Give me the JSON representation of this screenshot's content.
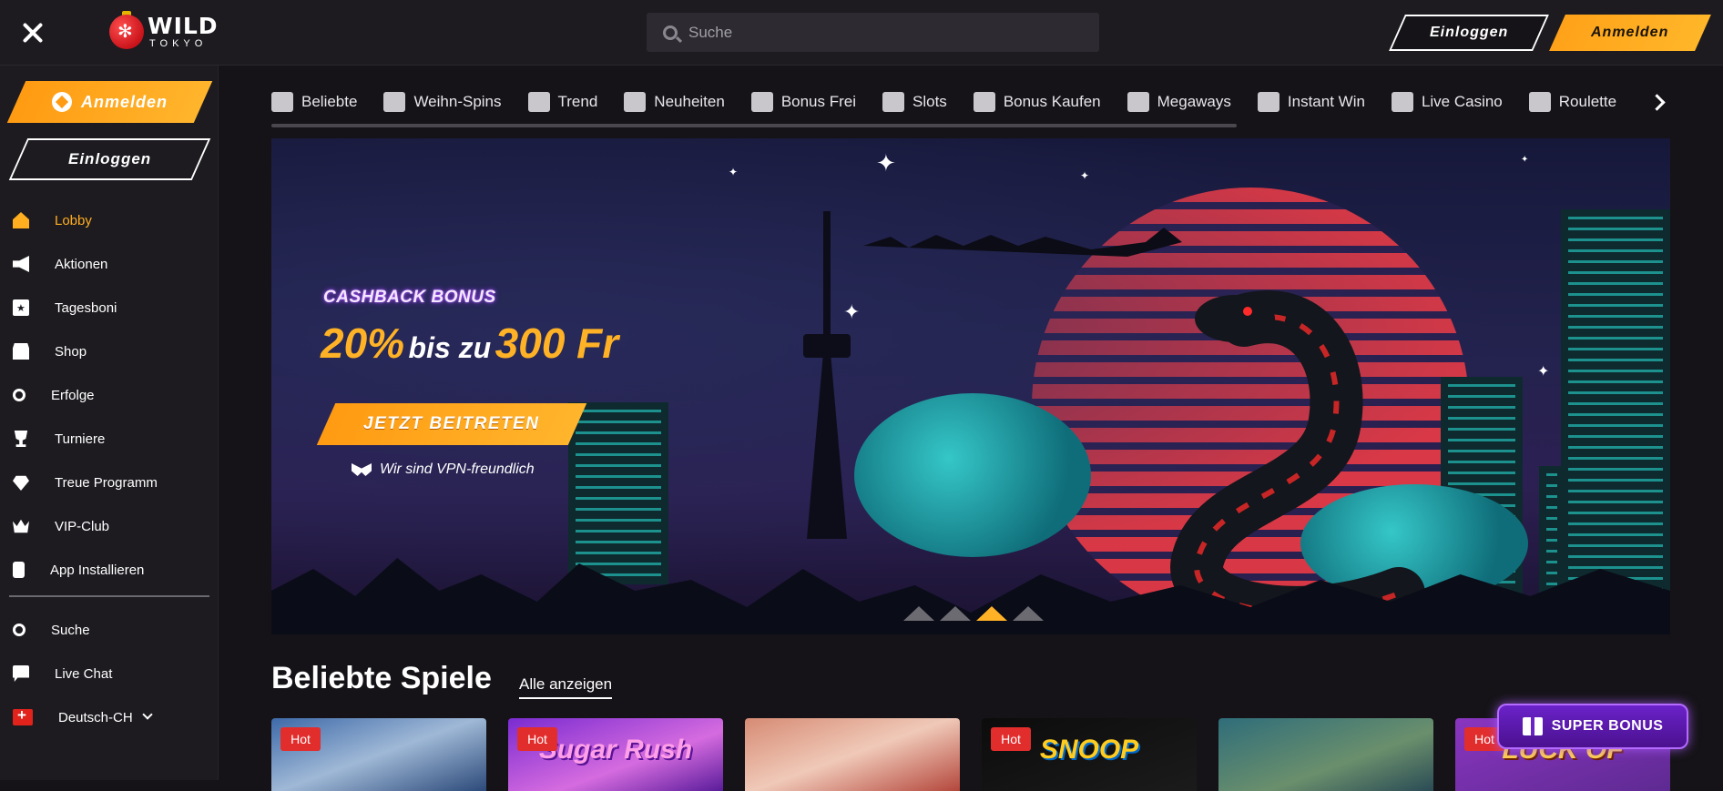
{
  "brand": {
    "name": "WILD",
    "sub": "TOKYO"
  },
  "topbar": {
    "search_placeholder": "Suche",
    "login_label": "Einloggen",
    "register_label": "Anmelden"
  },
  "sidebar": {
    "register_label": "Anmelden",
    "login_label": "Einloggen",
    "items": [
      {
        "label": "Lobby",
        "icon": "home-icon"
      },
      {
        "label": "Aktionen",
        "icon": "megaphone-icon"
      },
      {
        "label": "Tagesboni",
        "icon": "calendar-star-icon"
      },
      {
        "label": "Shop",
        "icon": "shop-icon"
      },
      {
        "label": "Erfolge",
        "icon": "award-icon"
      },
      {
        "label": "Turniere",
        "icon": "trophy-icon"
      },
      {
        "label": "Treue Programm",
        "icon": "diamond-icon"
      },
      {
        "label": "VIP-Club",
        "icon": "crown-icon"
      },
      {
        "label": "App Installieren",
        "icon": "phone-icon"
      }
    ],
    "bottom_items": [
      {
        "label": "Suche",
        "icon": "search-icon"
      },
      {
        "label": "Live Chat",
        "icon": "chat-icon"
      },
      {
        "label": "Deutsch-CH",
        "icon": "swiss-flag-icon"
      }
    ]
  },
  "categories": [
    "Beliebte",
    "Weihn-Spins",
    "Trend",
    "Neuheiten",
    "Bonus Frei",
    "Slots",
    "Bonus Kaufen",
    "Megaways",
    "Instant Win",
    "Live Casino",
    "Roulette"
  ],
  "banner": {
    "kicker": "CASHBACK BONUS",
    "percent": "20%",
    "middle": "bis zu",
    "amount": "300 Fr",
    "cta": "JETZT BEITRETEN",
    "vpn": "Wir sind VPN-freundlich"
  },
  "section": {
    "title": "Beliebte Spiele",
    "link": "Alle anzeigen",
    "games": [
      {
        "badge": "Hot",
        "title": ""
      },
      {
        "badge": "Hot",
        "title": "Sugar Rush"
      },
      {
        "badge": "",
        "title": ""
      },
      {
        "badge": "Hot",
        "title": "SNOOP"
      },
      {
        "badge": "",
        "title": ""
      },
      {
        "badge": "Hot",
        "title": "LUCK OF"
      }
    ]
  },
  "super_bonus": "SUPER BONUS",
  "colors": {
    "accent": "#ffae1f",
    "background": "#151317",
    "panel": "#1d1b20",
    "hot": "#e22d2d"
  }
}
